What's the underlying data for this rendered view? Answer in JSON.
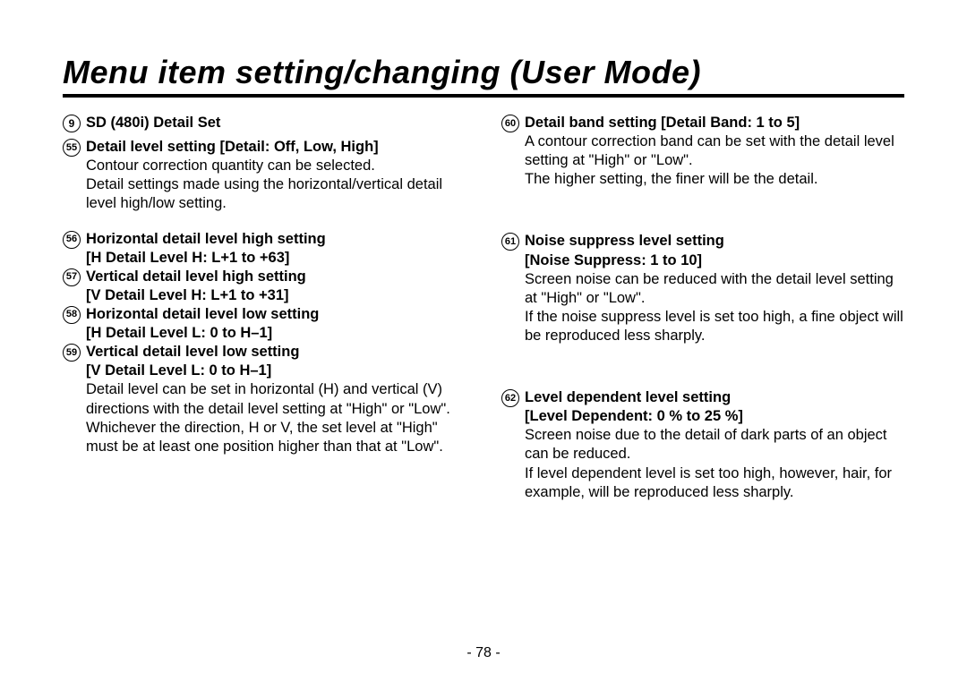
{
  "title": "Menu item setting/changing (User Mode)",
  "page_number": "- 78 -",
  "left": {
    "section": {
      "num": "9",
      "title": "SD (480i) Detail Set"
    },
    "i55": {
      "num": "55",
      "title": "Detail level setting [Detail: Off, Low, High]",
      "body1": "Contour correction quantity can be selected.",
      "body2": "Detail settings made using the horizontal/vertical detail level high/low setting."
    },
    "i56": {
      "num": "56",
      "title": "Horizontal detail level high setting",
      "sub": "[H Detail Level H: L+1 to +63]"
    },
    "i57": {
      "num": "57",
      "title": "Vertical detail level high setting",
      "sub": "[V Detail Level H: L+1 to +31]"
    },
    "i58": {
      "num": "58",
      "title": "Horizontal detail level low setting",
      "sub": "[H Detail Level L: 0 to H–1]"
    },
    "i59": {
      "num": "59",
      "title": "Vertical detail level low setting",
      "sub": "[V Detail Level L: 0 to H–1]",
      "body1": "Detail level can be set in horizontal (H) and vertical (V) directions with the detail level setting at \"High\" or \"Low\". Whichever the direction, H or V, the set level at \"High\" must be at least one position higher than that at \"Low\"."
    }
  },
  "right": {
    "i60": {
      "num": "60",
      "title": "Detail band setting [Detail Band: 1 to 5]",
      "body1": "A contour correction band can be set with the detail level setting at \"High\" or \"Low\".",
      "body2": "The higher setting, the finer will be the detail."
    },
    "i61": {
      "num": "61",
      "title": "Noise suppress level setting",
      "sub": "[Noise Suppress: 1 to 10]",
      "body1": "Screen noise can be reduced with the detail level setting at \"High\" or \"Low\".",
      "body2": "If the noise suppress level is set too high, a fine object will be reproduced less sharply."
    },
    "i62": {
      "num": "62",
      "title": "Level dependent level setting",
      "sub": "[Level Dependent: 0 % to 25 %]",
      "body1": "Screen noise due to the detail of dark parts of an object can be reduced.",
      "body2": "If level dependent level is set too high, however, hair, for example, will be reproduced less sharply."
    }
  }
}
